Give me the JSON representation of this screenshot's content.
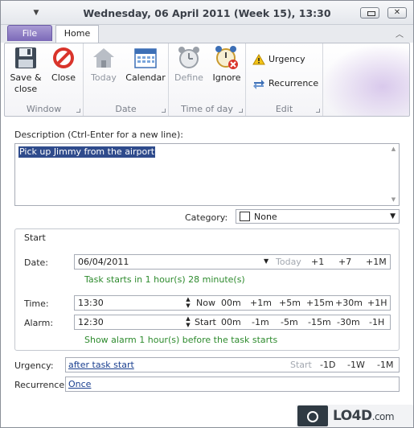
{
  "window": {
    "title": "Wednesday, 06 April 2011 (Week 15), 13:30"
  },
  "ribbon": {
    "tabs": [
      {
        "label": "File"
      },
      {
        "label": "Home"
      }
    ],
    "groups": {
      "window": {
        "label": "Window",
        "save_close": "Save & close",
        "close": "Close"
      },
      "date": {
        "label": "Date",
        "today": "Today",
        "calendar": "Calendar"
      },
      "time_of_day": {
        "label": "Time of day",
        "define": "Define",
        "ignore": "Ignore"
      },
      "edit": {
        "label": "Edit",
        "urgency": "Urgency",
        "recurrence": "Recurrence"
      }
    }
  },
  "description": {
    "label": "Description (Ctrl-Enter for a new line):",
    "value": "Pick up Jimmy from the airport"
  },
  "category": {
    "label": "Category:",
    "value": "None"
  },
  "start": {
    "title": "Start",
    "date": {
      "label": "Date:",
      "value": "06/04/2011",
      "quick": [
        "Today",
        "+1",
        "+7",
        "+1M"
      ],
      "hint": "Task starts in 1 hour(s) 28 minute(s)"
    },
    "time": {
      "label": "Time:",
      "value": "13:30",
      "quick": [
        "Now",
        "00m",
        "+1m",
        "+5m",
        "+15m",
        "+30m",
        "+1H"
      ]
    },
    "alarm": {
      "label": "Alarm:",
      "value": "12:30",
      "quick": [
        "Start",
        "00m",
        "-1m",
        "-5m",
        "-15m",
        "-30m",
        "-1H"
      ],
      "hint": "Show alarm 1 hour(s) before the task starts"
    }
  },
  "urgency": {
    "label": "Urgency:",
    "value": "after task start",
    "quick": [
      "Start",
      "-1D",
      "-1W",
      "-1M"
    ]
  },
  "recurrence": {
    "label": "Recurrence:",
    "value": "Once"
  },
  "watermark": {
    "text": "LO4D",
    "suffix": ".com"
  },
  "colors": {
    "file_tab": "#7b69b8",
    "selection": "#2f4b8c",
    "hint_green": "#2e8b2e",
    "link": "#1a3f8f"
  }
}
